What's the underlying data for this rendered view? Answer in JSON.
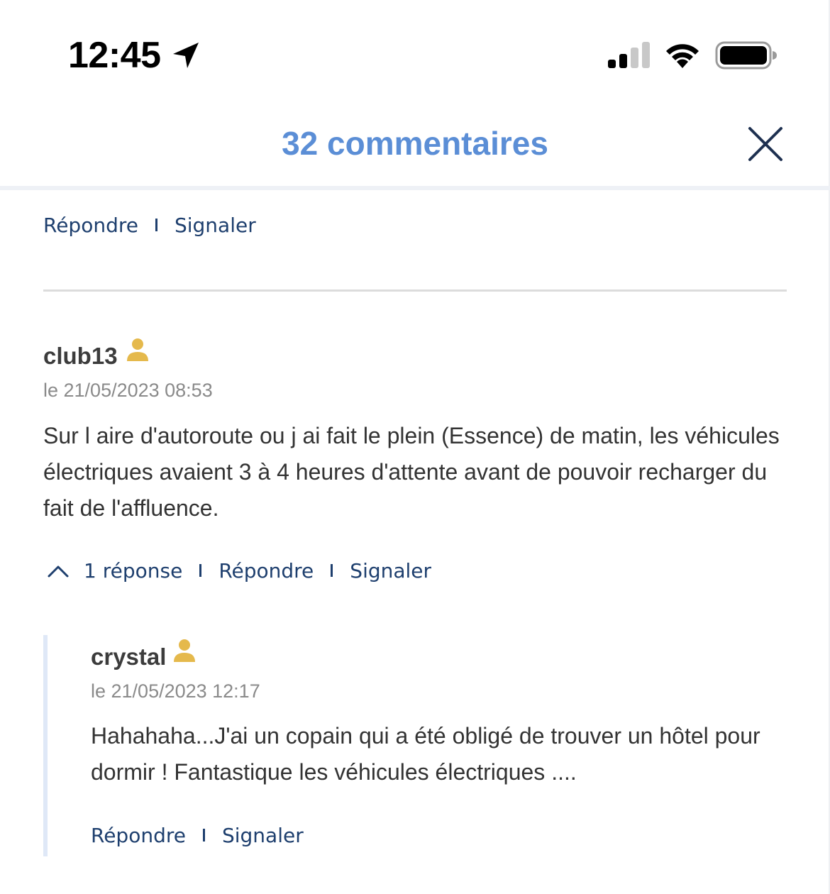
{
  "status_bar": {
    "time": "12:45",
    "icons": [
      "location-arrow-icon",
      "cellular-signal-icon",
      "wifi-icon",
      "battery-icon"
    ]
  },
  "header": {
    "title": "32 commentaires",
    "title_color": "#5b8ed6",
    "close_icon": "close-icon"
  },
  "previous_comment_actions": {
    "reply": "Répondre",
    "report": "Signaler"
  },
  "comments": [
    {
      "author": "club13",
      "author_icon": "user-icon",
      "date": "le 21/05/2023 08:53",
      "text": "Sur l aire d'autoroute ou j ai fait le plein (Essence) de matin, les véhicules électriques avaient 3 à 4 heures d'attente avant de pouvoir recharger du fait de l'affluence.",
      "actions": {
        "toggle_replies": "1 réponse",
        "reply": "Répondre",
        "report": "Signaler"
      },
      "replies": [
        {
          "author": "crystal",
          "author_icon": "user-icon",
          "date": "le 21/05/2023 12:17",
          "text": "Hahahaha...J'ai un copain qui a été obligé de trouver un hôtel pour dormir ! Fantastique les véhicules électriques ....",
          "actions": {
            "reply": "Répondre",
            "report": "Signaler"
          }
        }
      ]
    }
  ],
  "colors": {
    "link": "#1e3f6e",
    "user_icon": "#e5b94c",
    "reply_bar": "#dfe8f7"
  }
}
